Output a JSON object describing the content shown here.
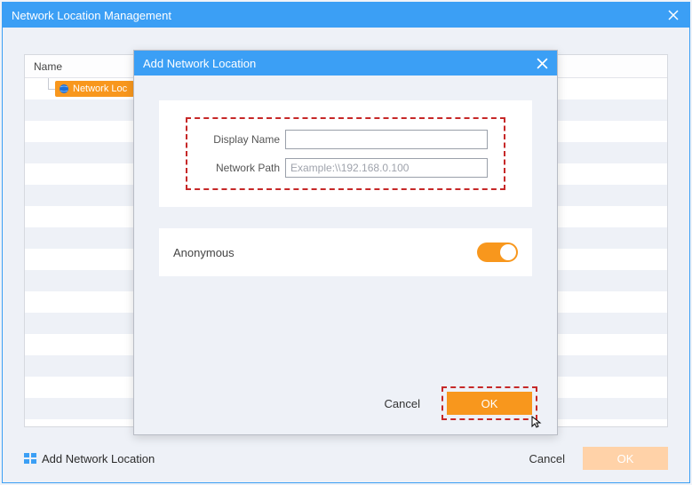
{
  "mainWindow": {
    "title": "Network Location Management"
  },
  "table": {
    "header": "Name",
    "selectedItem": "Network Loc"
  },
  "bottom": {
    "addLink": "Add Network Location",
    "cancel": "Cancel",
    "ok": "OK"
  },
  "dialog": {
    "title": "Add Network Location",
    "fields": {
      "displayNameLabel": "Display Name",
      "displayNameValue": "",
      "networkPathLabel": "Network Path",
      "networkPathPlaceholder": "Example:\\\\192.168.0.100"
    },
    "anonymousLabel": "Anonymous",
    "anonymousOn": true,
    "cancel": "Cancel",
    "ok": "OK"
  },
  "colors": {
    "primary": "#3b9ff5",
    "accent": "#f8971d",
    "highlight": "#c62828"
  }
}
